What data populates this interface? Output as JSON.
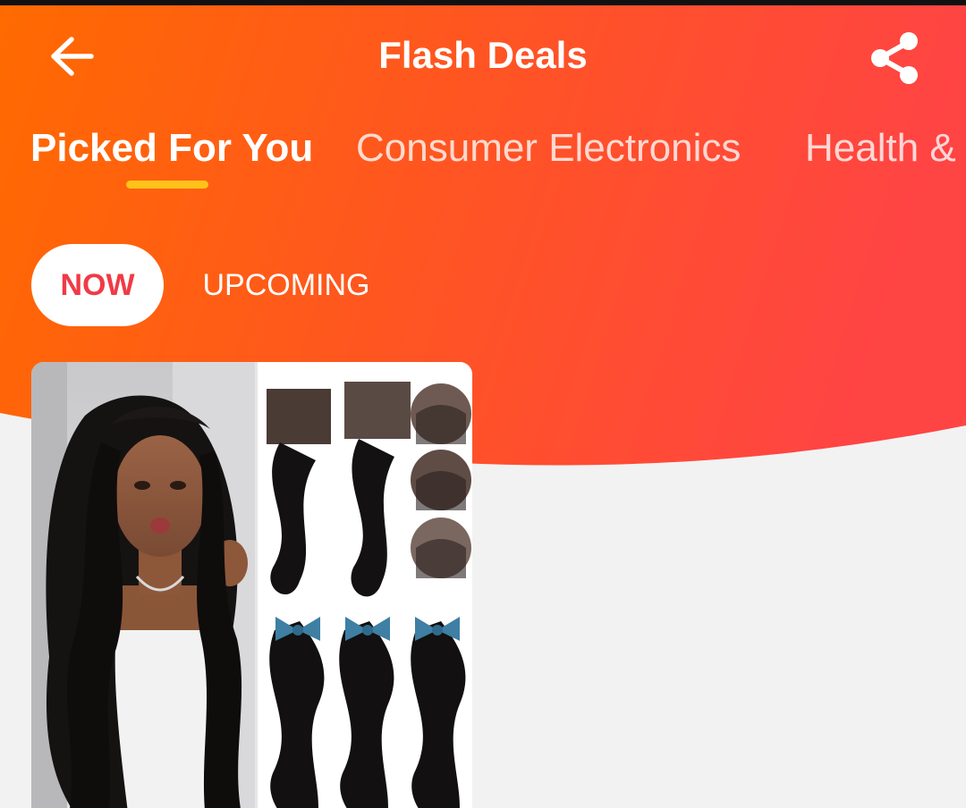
{
  "header": {
    "title": "Flash Deals",
    "back_icon": "arrow-left-icon",
    "share_icon": "share-icon"
  },
  "tabs": [
    {
      "label": "Picked For You",
      "active": true
    },
    {
      "label": "Consumer Electronics",
      "active": false
    },
    {
      "label": "Health & ",
      "active": false
    }
  ],
  "segments": {
    "now": "NOW",
    "upcoming": "UPCOMING",
    "selected": "now"
  },
  "colors": {
    "gradient_start": "#ff6a00",
    "gradient_end": "#ff4444",
    "tab_indicator": "#ffc21a",
    "now_text": "#ef3b46",
    "background": "#f2f2f2"
  },
  "product": {
    "image_description_icon": "hair-bundles-product-image"
  }
}
